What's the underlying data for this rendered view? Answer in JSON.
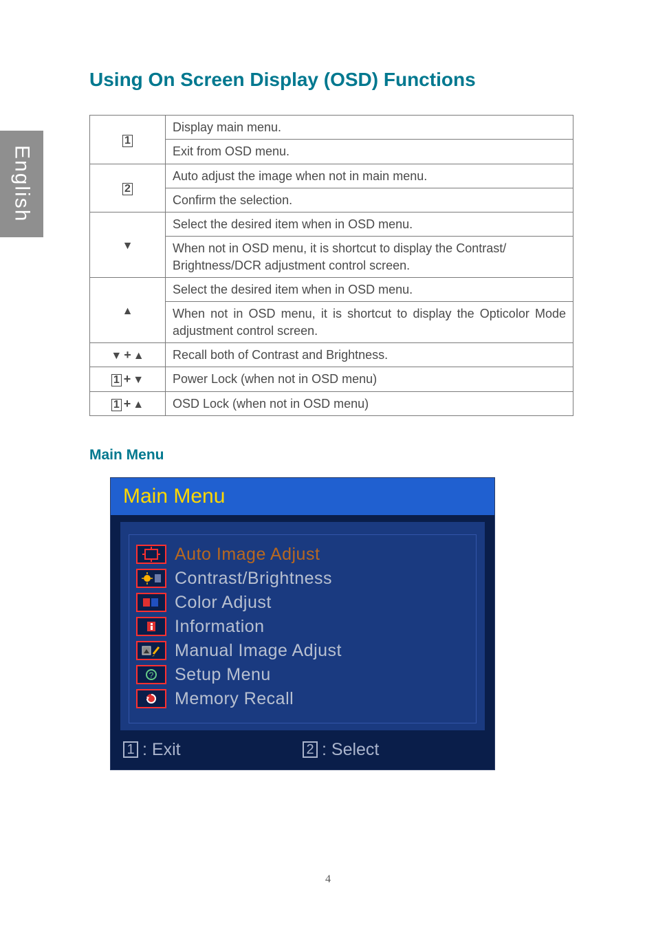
{
  "sideTab": "English",
  "title": "Using On Screen Display (OSD) Functions",
  "rows": {
    "r1a": "Display main menu.",
    "r1b": "Exit from OSD menu.",
    "r2a": "Auto adjust the image when not in main menu.",
    "r2b": "Confirm the selection.",
    "rDownA": "Select the desired item when in OSD menu.",
    "rDownB": "When not in OSD menu, it is shortcut to display the Contrast/ Brightness/DCR adjustment control screen.",
    "rUpA": "Select the desired item when in OSD menu.",
    "rUpB": "When not in OSD menu, it is shortcut to display the Opticolor Mode adjustment control screen.",
    "rDU": "Recall both of Contrast and Brightness.",
    "r1Down": "Power Lock (when not in OSD menu)",
    "r1Up": "OSD Lock (when not in OSD menu)"
  },
  "keys": {
    "k1": "1",
    "k2": "2",
    "down": "▼",
    "up": "▲",
    "plus": "+"
  },
  "subhead": "Main Menu",
  "osd": {
    "title": "Main Menu",
    "items": [
      {
        "label": "Auto Image Adjust",
        "selected": true
      },
      {
        "label": "Contrast/Brightness",
        "selected": false
      },
      {
        "label": "Color Adjust",
        "selected": false
      },
      {
        "label": "Information",
        "selected": false
      },
      {
        "label": "Manual Image Adjust",
        "selected": false
      },
      {
        "label": "Setup Menu",
        "selected": false
      },
      {
        "label": "Memory Recall",
        "selected": false
      }
    ],
    "footer": {
      "k1": "1",
      "l1": ": Exit",
      "k2": "2",
      "l2": ": Select"
    }
  },
  "pageNumber": "4"
}
